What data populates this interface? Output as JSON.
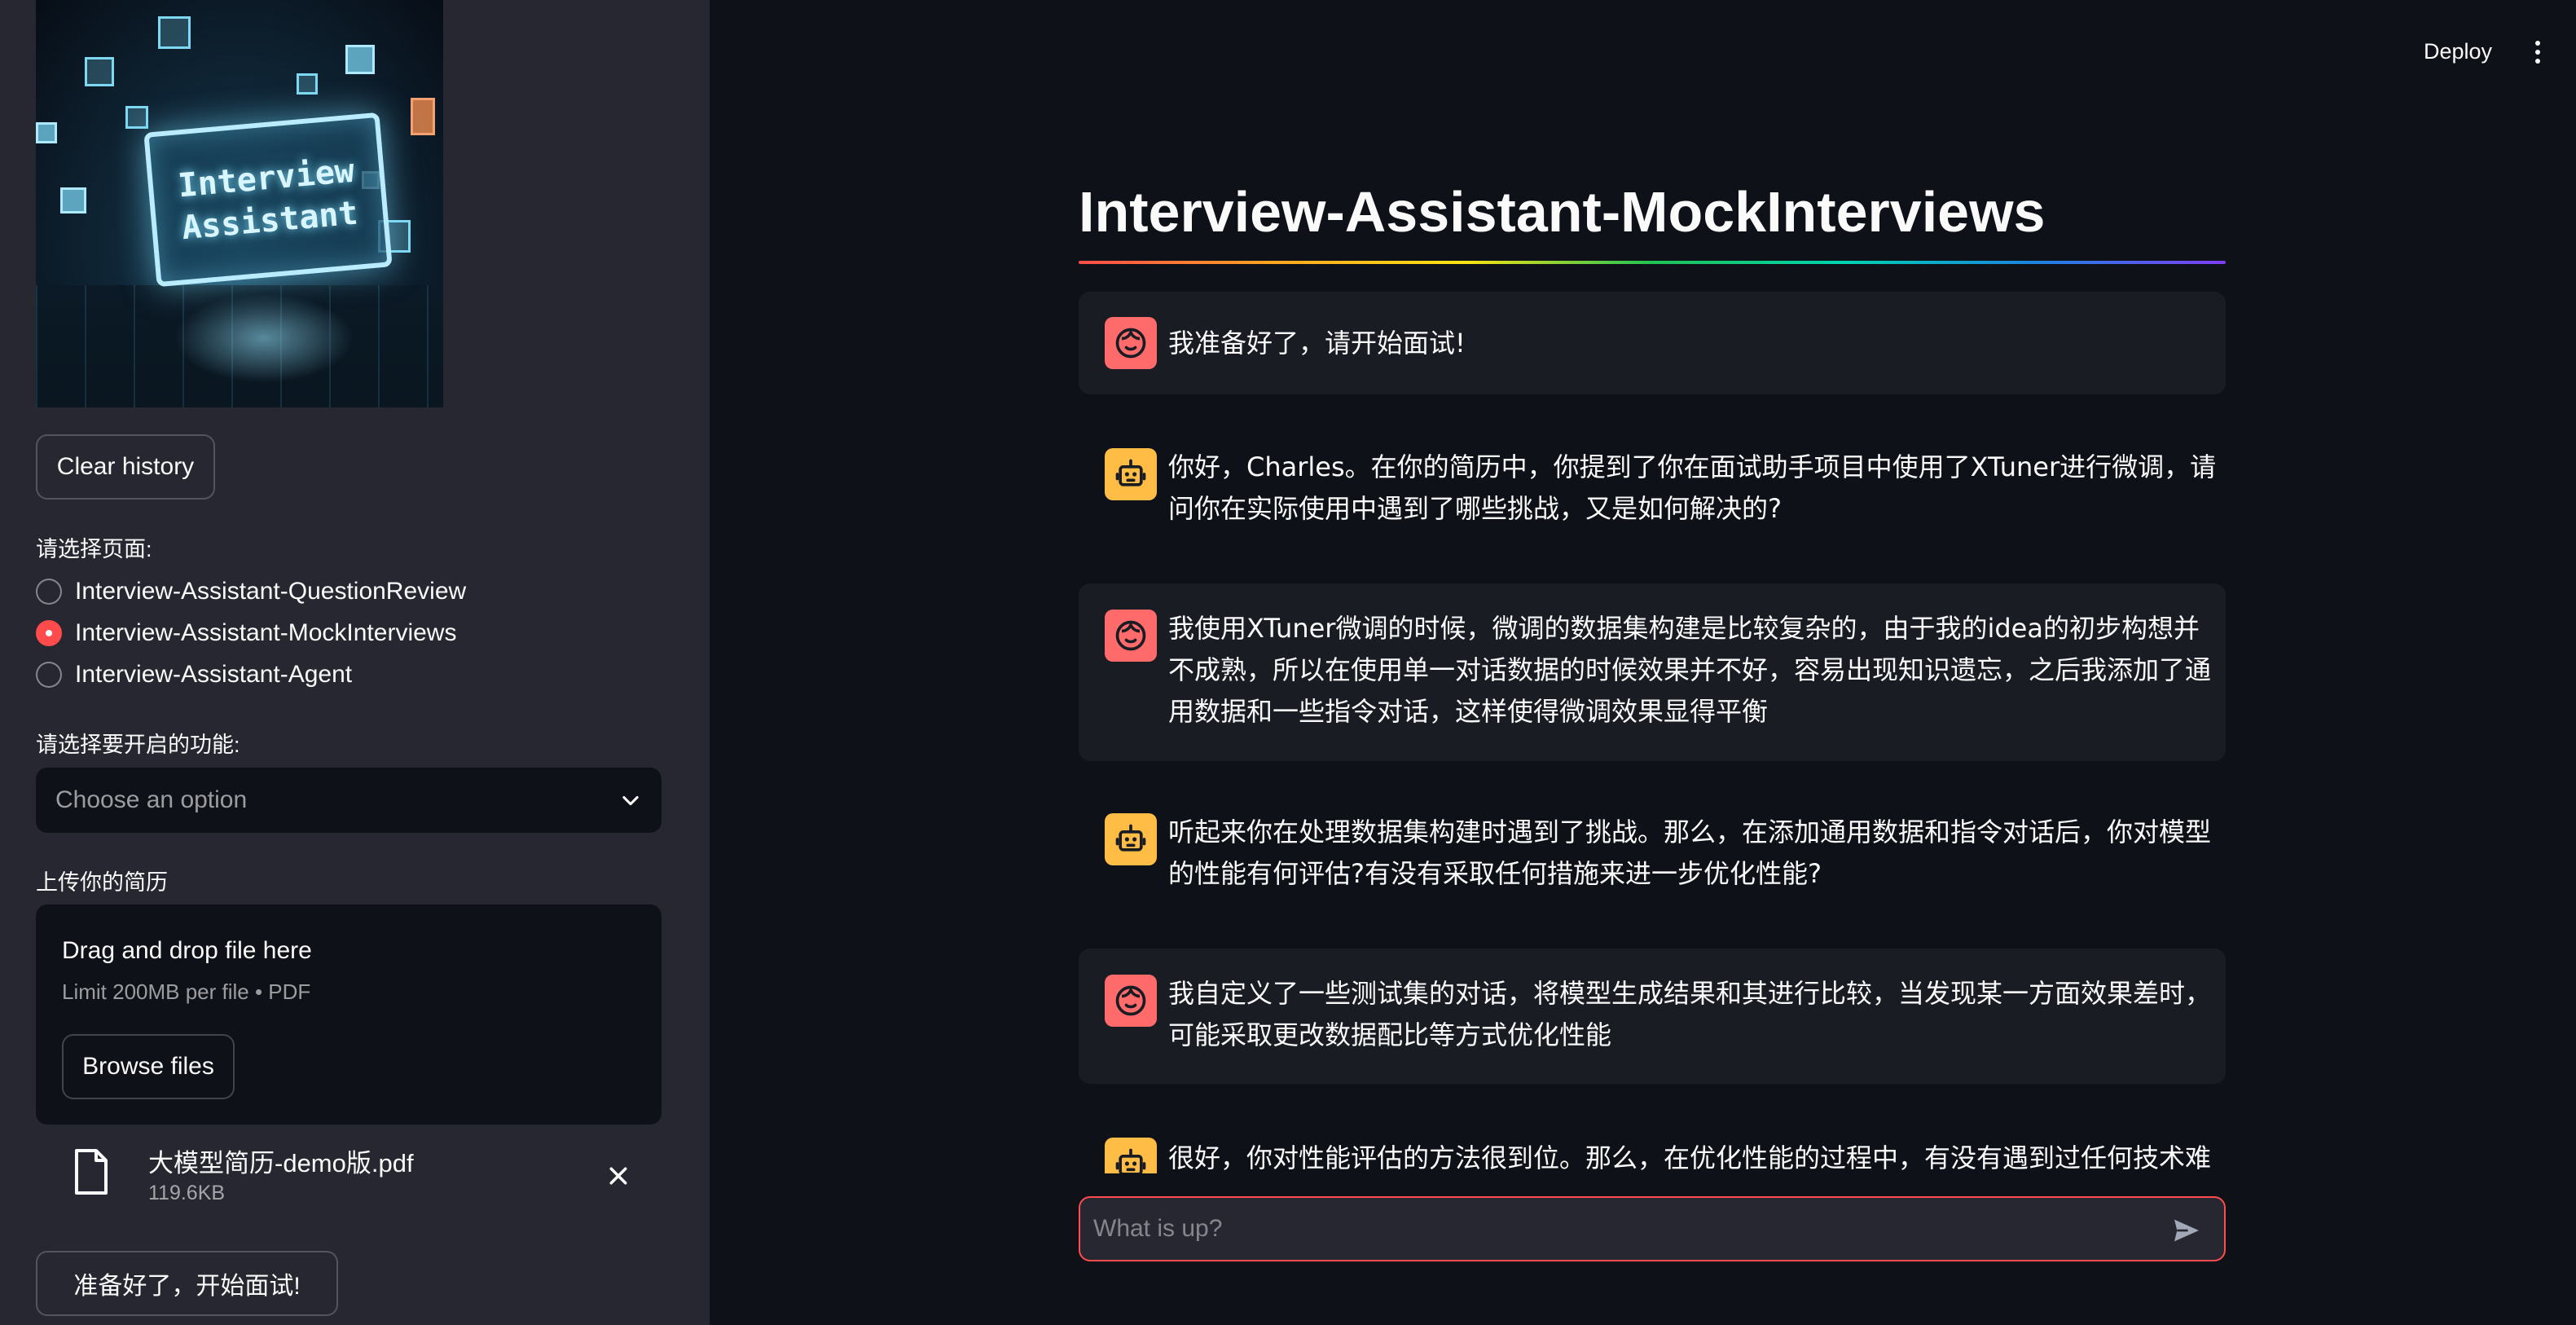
{
  "sidebar": {
    "logo_text": [
      "Interview",
      "Assistant"
    ],
    "clear_history_label": "Clear history",
    "page_select_label": "请选择页面:",
    "pages": [
      {
        "label": "Interview-Assistant-QuestionReview",
        "selected": false
      },
      {
        "label": "Interview-Assistant-MockInterviews",
        "selected": true
      },
      {
        "label": "Interview-Assistant-Agent",
        "selected": false
      }
    ],
    "feature_select_label": "请选择要开启的功能:",
    "feature_select_placeholder": "Choose an option",
    "upload_label": "上传你的简历",
    "dropzone": {
      "title": "Drag and drop file here",
      "subtitle": "Limit 200MB per file • PDF",
      "browse_label": "Browse files"
    },
    "uploaded_file": {
      "name": "大模型简历-demo版.pdf",
      "size": "119.6KB"
    },
    "start_button_label": "准备好了，开始面试!"
  },
  "header": {
    "deploy_label": "Deploy"
  },
  "main": {
    "title": "Interview-Assistant-MockInterviews",
    "messages": [
      {
        "role": "user",
        "text": "我准备好了，请开始面试!"
      },
      {
        "role": "assistant",
        "text": "你好，Charles。在你的简历中，你提到了你在面试助手项目中使用了XTuner进行微调，请问你在实际使用中遇到了哪些挑战，又是如何解决的?"
      },
      {
        "role": "user",
        "text": "我使用XTuner微调的时候，微调的数据集构建是比较复杂的，由于我的idea的初步构想并不成熟，所以在使用单一对话数据的时候效果并不好，容易出现知识遗忘，之后我添加了通用数据和一些指令对话，这样使得微调效果显得平衡"
      },
      {
        "role": "assistant",
        "text": "听起来你在处理数据集构建时遇到了挑战。那么，在添加通用数据和指令对话后，你对模型的性能有何评估?有没有采取任何措施来进一步优化性能?"
      },
      {
        "role": "user",
        "text": "我自定义了一些测试集的对话，将模型生成结果和其进行比较，当发现某一方面效果差时，可能采取更改数据配比等方式优化性能"
      },
      {
        "role": "assistant",
        "text": "很好，你对性能评估的方法很到位。那么，在优化性能的过程中，有没有遇到过任何技术难"
      }
    ],
    "chat_placeholder": "What is up?"
  },
  "colors": {
    "accent": "#ff4b4b",
    "user_avatar": "#ff6b6b",
    "bot_avatar": "#ffbd45",
    "sidebar_bg": "#262730",
    "main_bg": "#0e1117"
  }
}
